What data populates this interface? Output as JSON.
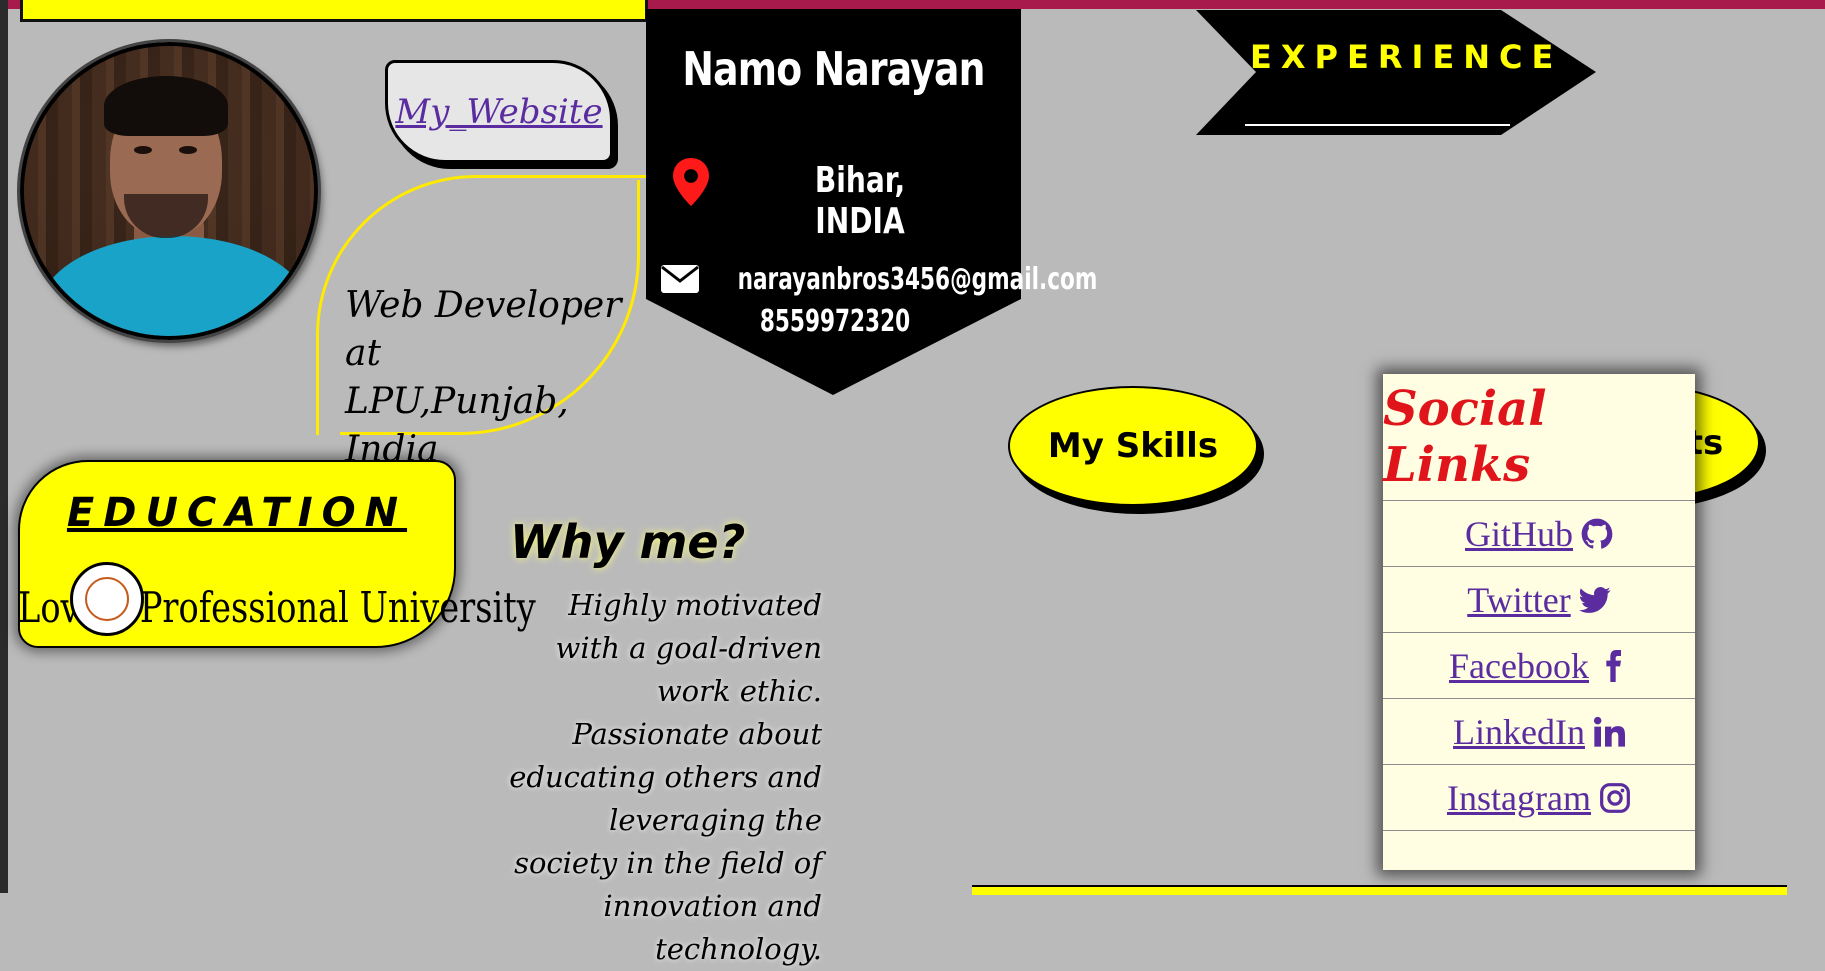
{
  "profile": {
    "name": "Namo Narayan",
    "location": "Bihar, INDIA",
    "email": "narayanbros3456@gmail.com",
    "phone": "8559972320",
    "role_line1": "Web Developer at",
    "role_line2": "LPU,Punjab, India"
  },
  "links": {
    "website_label": "My_Website"
  },
  "sections": {
    "experience_label": "EXPERIENCE",
    "skills_label": "My Skills",
    "projects_label": "Projects"
  },
  "social": {
    "title": "Social Links",
    "items": [
      {
        "label": "GitHub",
        "icon": "github-icon"
      },
      {
        "label": "Twitter",
        "icon": "twitter-icon"
      },
      {
        "label": "Facebook",
        "icon": "facebook-icon"
      },
      {
        "label": "LinkedIn",
        "icon": "linkedin-icon"
      },
      {
        "label": "Instagram",
        "icon": "instagram-icon"
      }
    ]
  },
  "education": {
    "title": "EDUCATION",
    "school": "Lovely Professional University"
  },
  "why": {
    "title": "Why me?",
    "text": "Highly motivated with a goal-driven work ethic. Passionate about educating others and leveraging the society in the field of innovation and technology."
  },
  "colors": {
    "background": "#bababa",
    "accent_yellow": "#ffff00",
    "top_bar": "#a81a4c",
    "link_purple": "#5a2ca0",
    "social_title_red": "#e0151b"
  }
}
